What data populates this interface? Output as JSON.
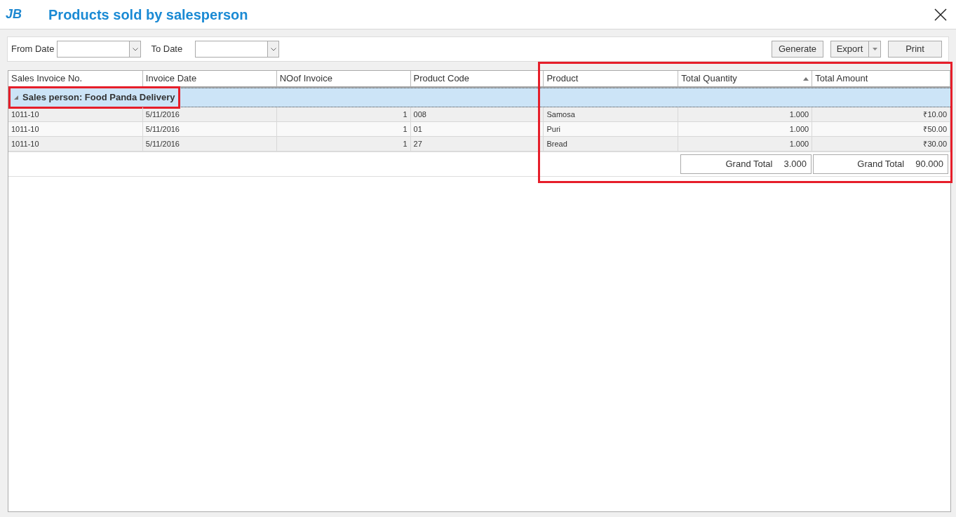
{
  "window": {
    "title": "Products sold by salesperson",
    "logo": "JB"
  },
  "filters": [
    {
      "label": "From Date"
    },
    {
      "label": "To Date"
    }
  ],
  "buttons": [
    {
      "label": "Generate",
      "kind": "plain"
    },
    {
      "label": "Export",
      "kind": "split"
    },
    {
      "label": "Print",
      "kind": "plain"
    }
  ],
  "table": {
    "columns": [
      {
        "label": "Sales Invoice No.",
        "sorted": false
      },
      {
        "label": "Invoice Date",
        "sorted": false
      },
      {
        "label": "NOof Invoice",
        "sorted": false
      },
      {
        "label": "Product Code",
        "sorted": false
      },
      {
        "label": "Product",
        "sorted": false
      },
      {
        "label": "Total Quantity",
        "sorted": true
      },
      {
        "label": "Total Amount",
        "sorted": false
      }
    ],
    "group": {
      "label": "Sales person: Food Panda Delivery",
      "expanded": true
    },
    "rows": [
      [
        "1011-10",
        "5/11/2016",
        "1",
        "008",
        "Samosa",
        "1.000",
        "₹10.00"
      ],
      [
        "1011-10",
        "5/11/2016",
        "1",
        "01",
        "Puri",
        "1.000",
        "₹50.00"
      ],
      [
        "1011-10",
        "5/11/2016",
        "1",
        "27",
        "Bread",
        "1.000",
        "₹30.00"
      ]
    ],
    "totals": [
      {
        "label": "Grand Total",
        "value": "3.000"
      },
      {
        "label": "Grand Total",
        "value": "90.000"
      }
    ]
  }
}
